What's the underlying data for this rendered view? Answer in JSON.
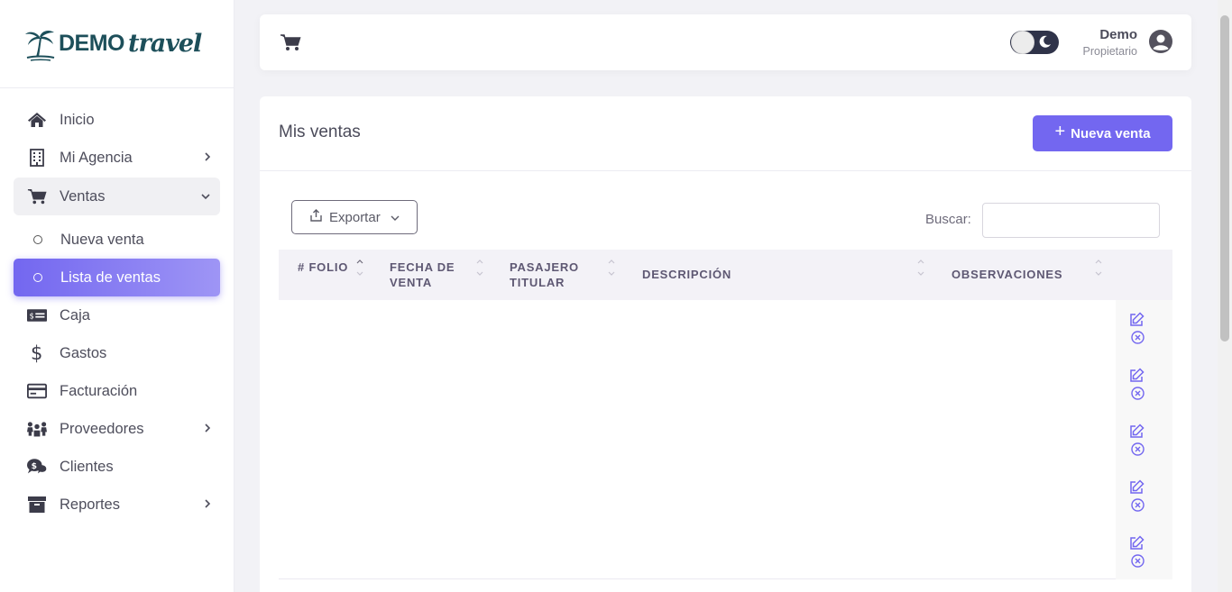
{
  "brand": {
    "name": "DEMO",
    "tagline": "travel"
  },
  "sidebar": {
    "items": [
      {
        "label": "Inicio",
        "icon": "home-icon"
      },
      {
        "label": "Mi Agencia",
        "icon": "building-icon",
        "expandable": true
      },
      {
        "label": "Ventas",
        "icon": "cart-icon",
        "expandable": true,
        "open": true,
        "children": [
          {
            "label": "Nueva venta"
          },
          {
            "label": "Lista de ventas",
            "active": true
          }
        ]
      },
      {
        "label": "Caja",
        "icon": "cash-icon"
      },
      {
        "label": "Gastos",
        "icon": "dollar-icon"
      },
      {
        "label": "Facturación",
        "icon": "credit-card-icon"
      },
      {
        "label": "Proveedores",
        "icon": "people-icon",
        "expandable": true
      },
      {
        "label": "Clientes",
        "icon": "chat-dollar-icon"
      },
      {
        "label": "Reportes",
        "icon": "archive-icon",
        "expandable": true
      }
    ]
  },
  "topbar": {
    "user_name": "Demo",
    "user_role": "Propietario",
    "dark_mode": false
  },
  "main": {
    "title": "Mis ventas",
    "new_button": "Nueva venta",
    "export_button": "Exportar",
    "search_label": "Buscar:",
    "search_value": "",
    "columns": [
      "# FOLIO",
      "FECHA DE VENTA",
      "PASAJERO TITULAR",
      "DESCRIPCIÓN",
      "OBSERVACIONES"
    ],
    "row_count": 5
  },
  "colors": {
    "accent": "#7367f0",
    "brand": "#1d4f5a",
    "toggle_bg": "#2f3349"
  }
}
